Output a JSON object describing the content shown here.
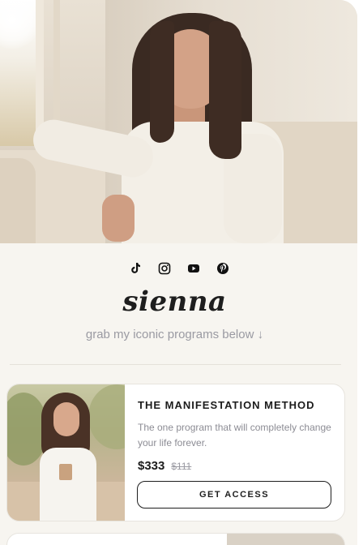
{
  "profile": {
    "name": "sienna",
    "tagline": "grab my iconic programs below ↓",
    "hero_image": "woman-on-sofa-photo"
  },
  "socials": [
    {
      "name": "tiktok-icon"
    },
    {
      "name": "instagram-icon"
    },
    {
      "name": "youtube-icon"
    },
    {
      "name": "pinterest-icon"
    }
  ],
  "product": {
    "image": "woman-with-coffee-photo",
    "title": "THE MANIFESTATION METHOD",
    "description": "The one program that will completely change your life forever.",
    "price": "$333",
    "old_price": "$111",
    "cta_label": "GET ACCESS"
  },
  "colors": {
    "background": "#f7f5f0",
    "text": "#1e1e1e",
    "muted": "#9a9aa2"
  }
}
